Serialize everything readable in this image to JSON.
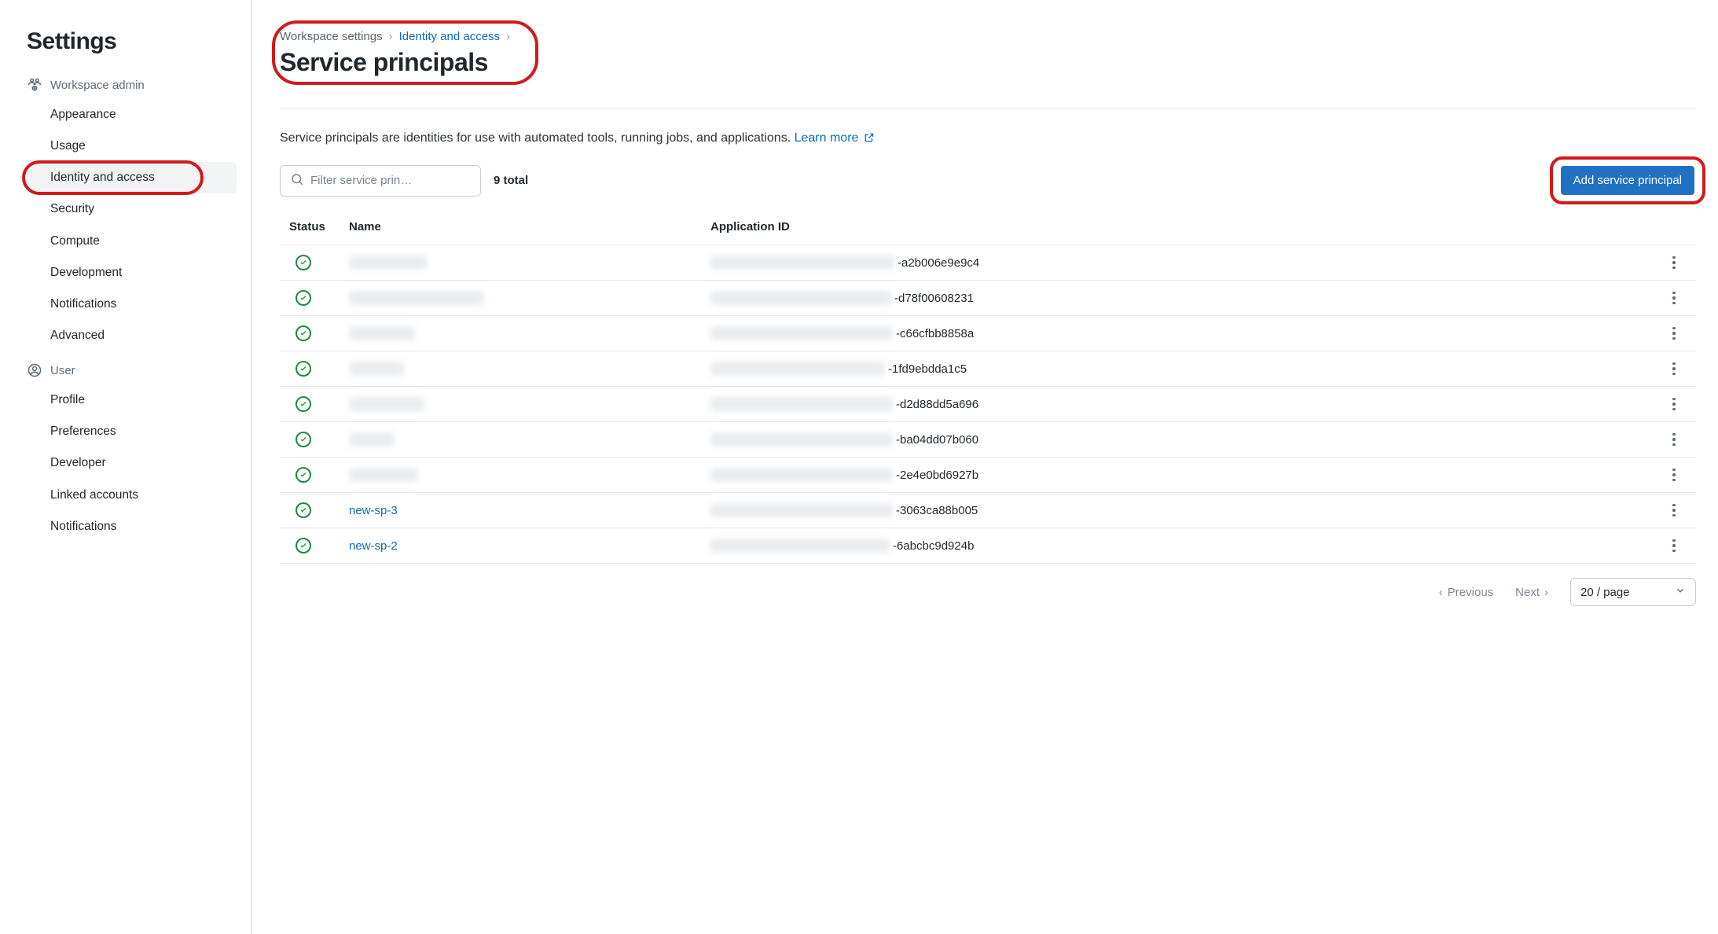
{
  "sidebar": {
    "title": "Settings",
    "sections": [
      {
        "label": "Workspace admin",
        "icon": "workspace-admin-icon",
        "items": [
          {
            "label": "Appearance"
          },
          {
            "label": "Usage"
          },
          {
            "label": "Identity and access",
            "active": true,
            "highlighted": true
          },
          {
            "label": "Security"
          },
          {
            "label": "Compute"
          },
          {
            "label": "Development"
          },
          {
            "label": "Notifications"
          },
          {
            "label": "Advanced"
          }
        ]
      },
      {
        "label": "User",
        "icon": "user-icon",
        "items": [
          {
            "label": "Profile"
          },
          {
            "label": "Preferences"
          },
          {
            "label": "Developer"
          },
          {
            "label": "Linked accounts"
          },
          {
            "label": "Notifications"
          }
        ]
      }
    ]
  },
  "breadcrumb": {
    "root": "Workspace settings",
    "second": "Identity and access"
  },
  "page_title": "Service principals",
  "description_text": "Service principals are identities for use with automated tools, running jobs, and applications. ",
  "learn_more": "Learn more",
  "search": {
    "placeholder": "Filter service prin…"
  },
  "total_label": "9 total",
  "add_button": "Add service principal",
  "columns": {
    "status": "Status",
    "name": "Name",
    "app_id": "Application ID"
  },
  "rows": [
    {
      "name": "",
      "name_blur_width": 100,
      "appid_blur_width": 234,
      "appid_suffix": "-a2b006e9e9c4"
    },
    {
      "name": "",
      "name_blur_width": 172,
      "appid_blur_width": 230,
      "appid_suffix": "-d78f00608231"
    },
    {
      "name": "",
      "name_blur_width": 84,
      "appid_blur_width": 232,
      "appid_suffix": "-c66cfbb8858a"
    },
    {
      "name": "",
      "name_blur_width": 70,
      "appid_blur_width": 222,
      "appid_suffix": "-1fd9ebdda1c5"
    },
    {
      "name": "",
      "name_blur_width": 96,
      "appid_blur_width": 232,
      "appid_suffix": "-d2d88dd5a696"
    },
    {
      "name": "",
      "name_blur_width": 58,
      "appid_blur_width": 232,
      "appid_suffix": "-ba04dd07b060"
    },
    {
      "name": "",
      "name_blur_width": 88,
      "appid_blur_width": 232,
      "appid_suffix": "-2e4e0bd6927b"
    },
    {
      "name": "new-sp-3",
      "name_blur_width": 0,
      "appid_blur_width": 232,
      "appid_suffix": "-3063ca88b005"
    },
    {
      "name": "new-sp-2",
      "name_blur_width": 0,
      "appid_blur_width": 228,
      "appid_suffix": "-6abcbc9d924b"
    }
  ],
  "pager": {
    "prev": "Previous",
    "next": "Next",
    "page_size": "20 / page"
  }
}
